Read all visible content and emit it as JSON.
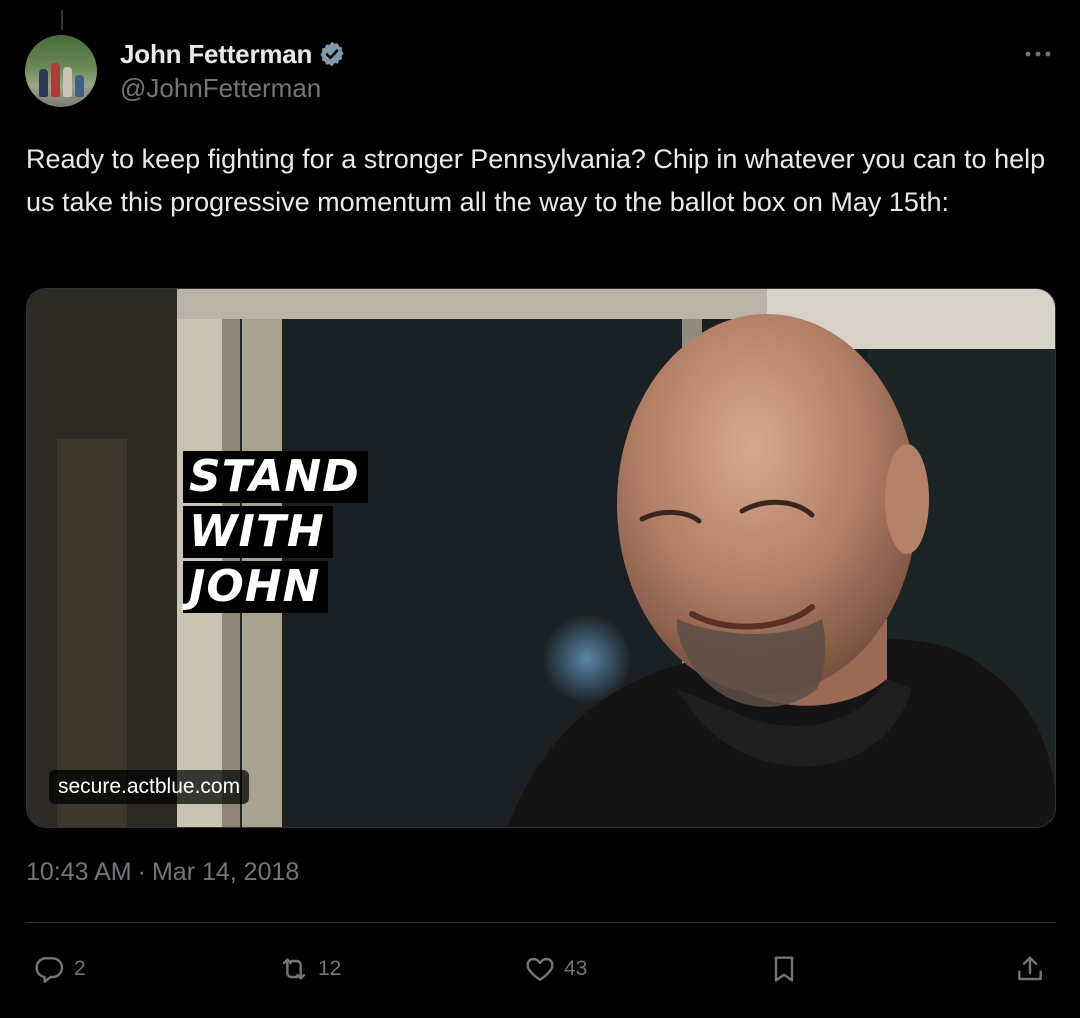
{
  "tweet": {
    "author": {
      "display_name": "John Fetterman",
      "handle": "@JohnFetterman",
      "verified": true
    },
    "text": "Ready to keep fighting for a stronger Pennsylvania? Chip in whatever you can to help us take this progressive momentum all the way to the ballot box on May 15th:",
    "card": {
      "overlay_lines": [
        "STAND",
        "WITH",
        "JOHN"
      ],
      "domain": "secure.actblue.com"
    },
    "time": "10:43 AM",
    "separator": "·",
    "date": "Mar 14, 2018",
    "actions": {
      "replies": "2",
      "reposts": "12",
      "likes": "43"
    }
  },
  "icons": {
    "verified": "verified-badge-icon",
    "more": "more-horizontal-icon",
    "reply": "reply-icon",
    "repost": "repost-icon",
    "like": "heart-icon",
    "bookmark": "bookmark-icon",
    "share": "share-icon"
  },
  "colors": {
    "background": "#000000",
    "text_primary": "#e7e9ea",
    "text_secondary": "#71767b",
    "border": "#2f3336",
    "verified_badge": "#829aab"
  }
}
